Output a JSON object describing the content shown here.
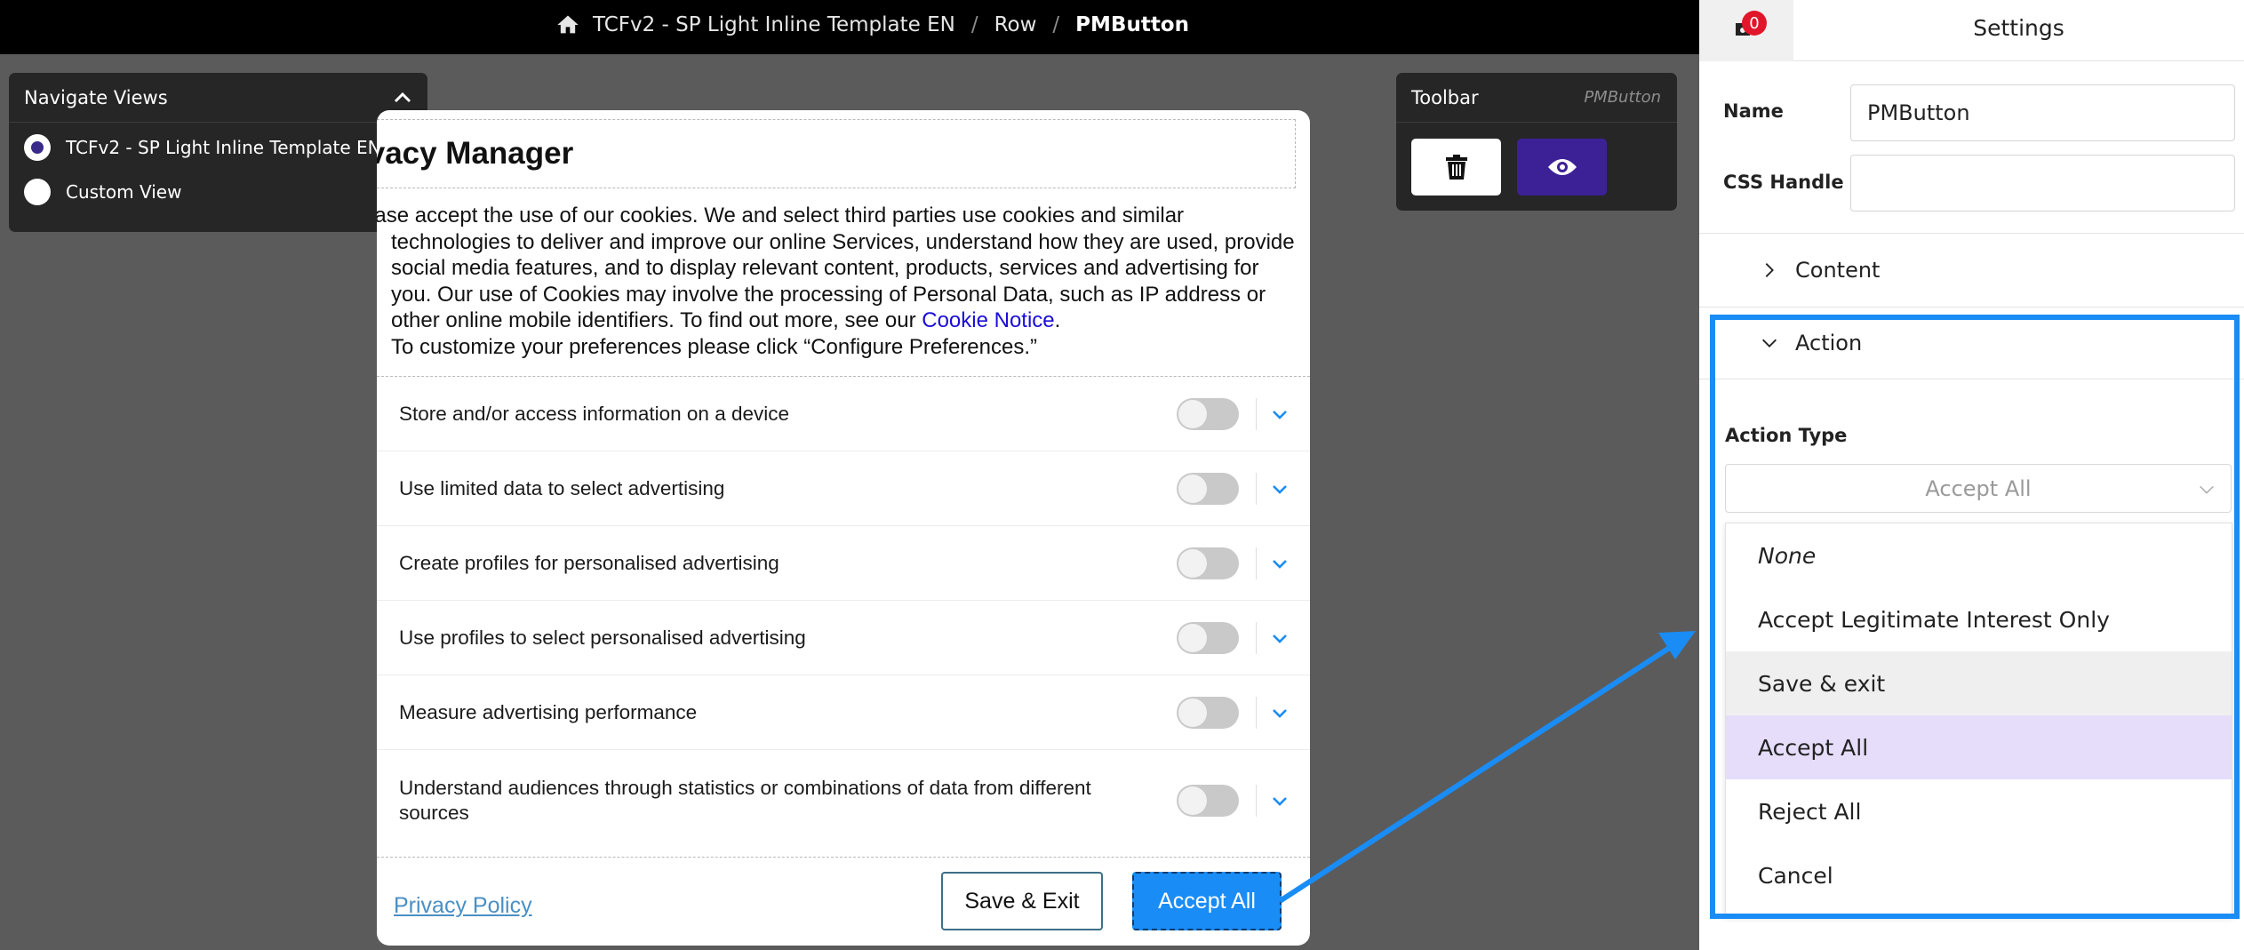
{
  "breadcrumb": {
    "items": [
      "TCFv2 - SP Light Inline Template EN",
      "Row",
      "PMButton"
    ],
    "separator": "/"
  },
  "navigate_views": {
    "title": "Navigate Views",
    "options": [
      {
        "label": "TCFv2 - SP Light Inline Template EN",
        "selected": true
      },
      {
        "label": "Custom View",
        "selected": false
      }
    ]
  },
  "toolbar": {
    "title": "Toolbar",
    "element": "PMButton",
    "delete_icon": "trash-icon",
    "view_icon": "eye-icon"
  },
  "privacy_manager": {
    "title": "ivacy Manager",
    "desc_line1": "ease accept the use of our cookies. We and select third parties use cookies and similar",
    "desc_rest": "technologies to deliver and improve our online Services, understand how they are used, provide social media features, and to display relevant content, products, services and advertising for you. Our use of Cookies may involve the processing of Personal Data, such as IP address or other online mobile identifiers. To find out more, see our",
    "cookie_link": "Cookie Notice",
    "desc_period": ".",
    "desc_last": "To customize your preferences please click “Configure Preferences.”",
    "purposes": [
      "Store and/or access information on a device",
      "Use limited data to select advertising",
      "Create profiles for personalised advertising",
      "Use profiles to select personalised advertising",
      "Measure advertising performance",
      "Understand audiences through statistics or combinations of data from different sources"
    ],
    "privacy_policy_link": "Privacy Policy",
    "save_exit_label": "Save & Exit",
    "accept_all_label": "Accept All"
  },
  "settings": {
    "notification_count": "0",
    "title": "Settings",
    "name_label": "Name",
    "name_value": "PMButton",
    "css_handle_label": "CSS Handle",
    "css_handle_value": "",
    "content_section": "Content",
    "action_section": "Action",
    "action_type_label": "Action Type",
    "action_type_value": "Accept All",
    "action_options": [
      "None",
      "Accept Legitimate Interest Only",
      "Save & exit",
      "Accept All",
      "Reject All",
      "Cancel"
    ]
  },
  "colors": {
    "accent": "#1a8cf5",
    "selected_option": "#e6ddfa",
    "view_button": "#3c2196",
    "badge": "#e2162a"
  }
}
